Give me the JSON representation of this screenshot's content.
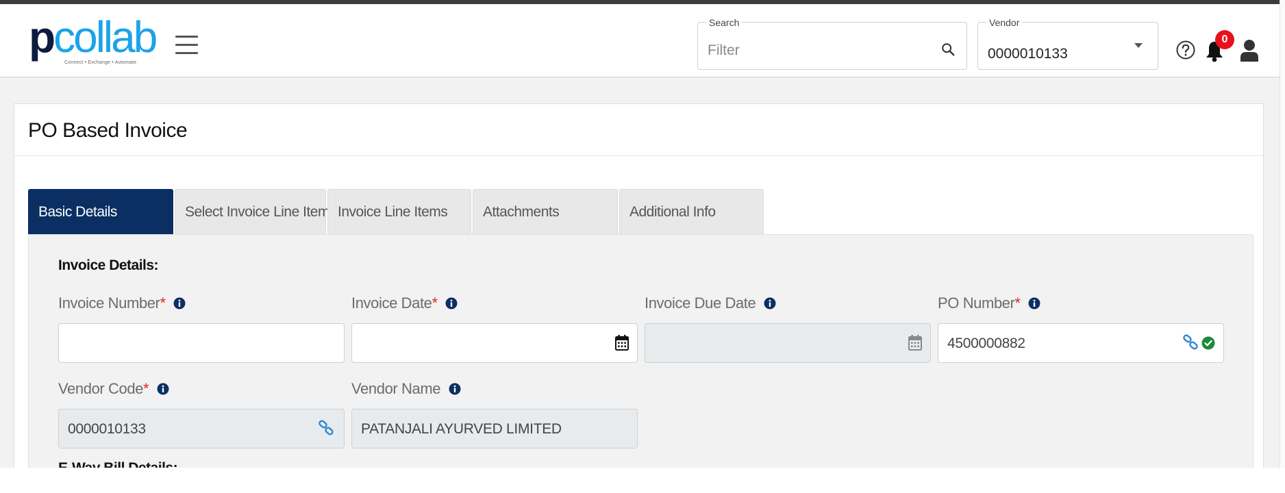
{
  "header": {
    "logo": {
      "main": "pcollab",
      "tagline": "Connect • Exchange • Automate"
    },
    "search": {
      "label": "Search",
      "placeholder": "Filter",
      "value": ""
    },
    "vendor": {
      "label": "Vendor",
      "selected": "0000010133"
    },
    "notifications": {
      "count": "0"
    }
  },
  "page": {
    "title": "PO Based Invoice"
  },
  "tabs": [
    {
      "label": "Basic Details",
      "active": true
    },
    {
      "label": "Select Invoice Line Items",
      "active": false
    },
    {
      "label": "Invoice Line Items",
      "active": false
    },
    {
      "label": "Attachments",
      "active": false
    },
    {
      "label": "Additional Info",
      "active": false
    }
  ],
  "invoice_details": {
    "heading": "Invoice Details:",
    "required_mark": "*",
    "fields": {
      "invoice_number": {
        "label": "Invoice Number",
        "required": true,
        "value": ""
      },
      "invoice_date": {
        "label": "Invoice Date",
        "required": true,
        "value": ""
      },
      "invoice_due_date": {
        "label": "Invoice Due Date",
        "required": false,
        "value": "",
        "disabled": true
      },
      "po_number": {
        "label": "PO Number",
        "required": true,
        "value": "4500000882"
      },
      "vendor_code": {
        "label": "Vendor Code",
        "required": true,
        "value": "0000010133",
        "disabled": true
      },
      "vendor_name": {
        "label": "Vendor Name",
        "required": false,
        "value": "PATANJALI AYURVED LIMITED",
        "disabled": true
      }
    }
  },
  "eway_bill": {
    "heading": "E-Way Bill Details:"
  },
  "colors": {
    "brand_navy": "#0b2f63",
    "brand_blue": "#1aa3e8",
    "required_red": "#d9262c",
    "badge_red": "#e8101c",
    "link_blue": "#2f86d6",
    "check_green": "#1c8a3a"
  },
  "icons": [
    "hamburger-icon",
    "search-icon",
    "chevron-down-icon",
    "help-icon",
    "bell-icon",
    "user-icon",
    "info-icon",
    "calendar-icon",
    "link-icon",
    "check-circle-icon"
  ]
}
